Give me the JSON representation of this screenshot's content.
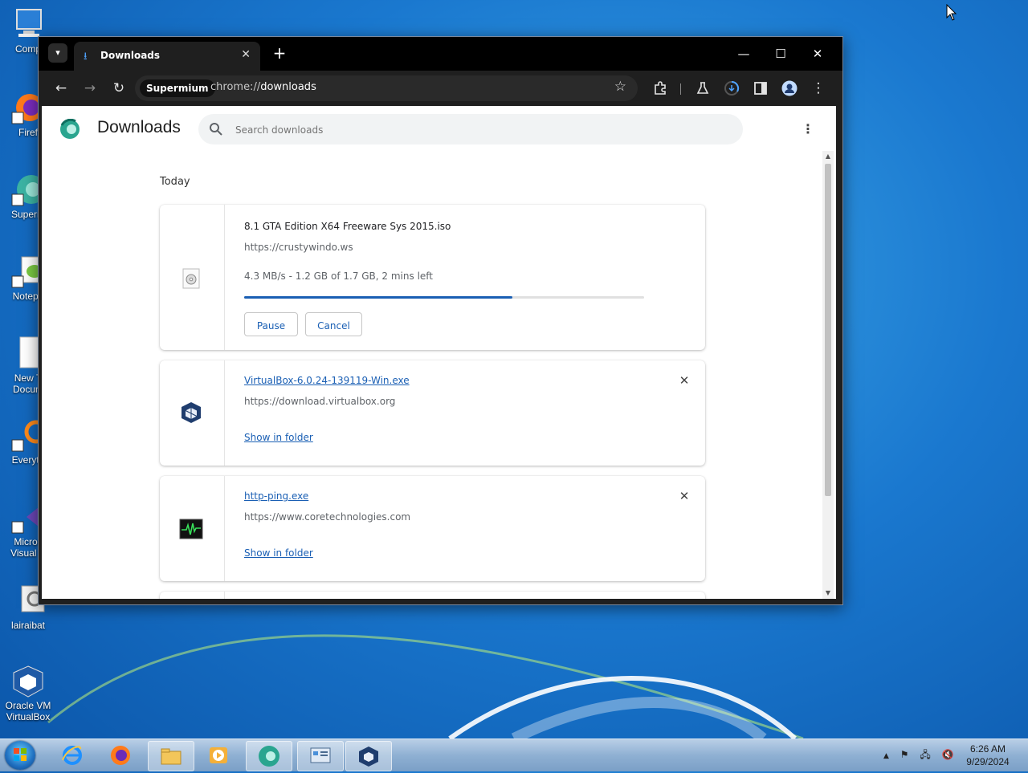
{
  "desktop": {
    "icons": [
      {
        "label": "Comp"
      },
      {
        "label": "Firef"
      },
      {
        "label": "Superm"
      },
      {
        "label": "Notepa"
      },
      {
        "label": "New T",
        "label2": "Docum"
      },
      {
        "label": "Everyth"
      },
      {
        "label": "Micros",
        "label2": "Visual S"
      },
      {
        "label": "lairaibat"
      },
      {
        "label": "Oracle VM",
        "label2": "VirtualBox"
      }
    ]
  },
  "browser": {
    "tab_title": "Downloads",
    "address_chip": "Supermium",
    "url_prefix": "chrome://",
    "url_host": "downloads"
  },
  "page": {
    "title": "Downloads",
    "search_placeholder": "Search downloads",
    "section_today": "Today",
    "downloads": [
      {
        "filename": "8.1 GTA Edition X64 Freeware Sys 2015.iso",
        "source": "https://crustywindo.ws",
        "status": "4.3 MB/s - 1.2 GB of 1.7 GB, 2 mins left",
        "progress": 0.67,
        "pause_label": "Pause",
        "cancel_label": "Cancel"
      },
      {
        "filename": "VirtualBox-6.0.24-139119-Win.exe",
        "source": "https://download.virtualbox.org",
        "action_label": "Show in folder"
      },
      {
        "filename": "http-ping.exe",
        "source": "https://www.coretechnologies.com",
        "action_label": "Show in folder"
      }
    ]
  },
  "taskbar": {
    "time": "6:26 AM",
    "date": "9/29/2024"
  },
  "colors": {
    "accent": "#1a5fb4",
    "window_chrome": "#1f1f1f",
    "desktop": "#1a78cf"
  }
}
